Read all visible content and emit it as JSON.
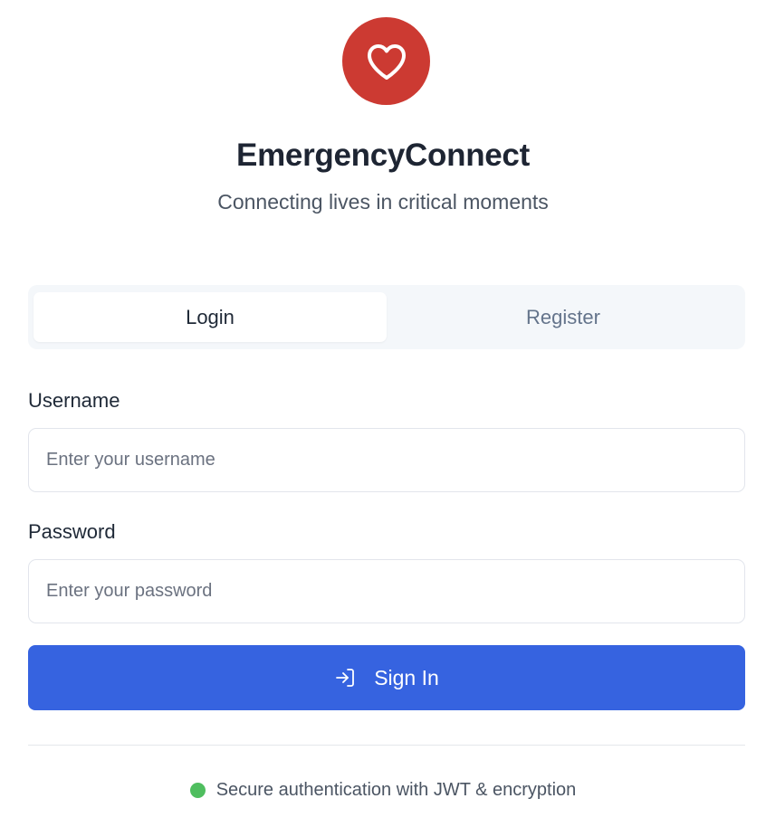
{
  "brand": {
    "name": "EmergencyConnect",
    "tagline": "Connecting lives in critical moments",
    "logo_icon": "heart-icon",
    "logo_color": "#cc3a32"
  },
  "tabs": [
    {
      "label": "Login",
      "active": true
    },
    {
      "label": "Register",
      "active": false
    }
  ],
  "form": {
    "username": {
      "label": "Username",
      "placeholder": "Enter your username",
      "value": ""
    },
    "password": {
      "label": "Password",
      "placeholder": "Enter your password",
      "value": ""
    },
    "submit": {
      "label": "Sign In",
      "icon": "sign-in-icon",
      "color": "#3663e0"
    }
  },
  "footer": {
    "secure_text": "Secure authentication with JWT & encryption",
    "status_color": "#4fbe5f"
  }
}
